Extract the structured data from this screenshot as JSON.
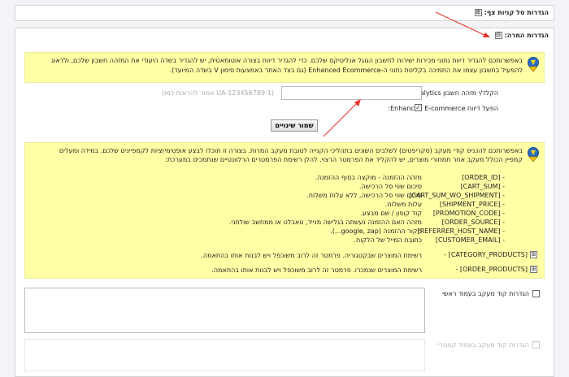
{
  "collapsed_panel": {
    "title": "הגדרות סל קניות צף:",
    "toggle_symbol": "⊞"
  },
  "open_panel": {
    "title": "הגדרות המרה:",
    "toggle_symbol": "⊟"
  },
  "note1": {
    "text": "באפשרותכם להגדיר דיווח נתוני מכירות ישירות לחשבון הגוגל אנליטיקס שלכם. כדי להגדיר דיווח בצורה אוטומאטית, יש להגדיר בשדה היעודי את המזהה חשבון שלכם, ולדאוג להפעיל בחשבון עצמו את התמיכה בקליטת נתוני ה-Enhanced Ecommerce (גם בצד האתר באמצעות סימון V בשדה המיועד)."
  },
  "ga_field": {
    "label": "הקלד/י מזהה חשבון Google Analytics:",
    "value": "",
    "hint": "(אמור להראות כמו UA-123456789-1)"
  },
  "enhanced_ecommerce": {
    "label": "הפעל דיווח Enhanced E-commerce:",
    "checked_symbol": "✓"
  },
  "save_button": {
    "label": "שמור שינויים"
  },
  "note2": {
    "intro": "באפשרותכם להכניס קודי מעקב (סקריפטים) לשלבים השונים בתהליכי הקנייה לטובת מעקב המרות. בצורה זו תוכלו לבצע אופטימיזציות לקמפיינים שלכם. במידה ומעלים קמפיין הכולל מעקב אחר תמחורי מוצרים, יש להקליד את הפרמטר הרצוי. להלן רשימת הפרמטרים הרלוונטיים שנתמכים במערכת:",
    "params": [
      {
        "code": "[ORDER_ID] -",
        "desc": "מזהה ההזמנה - מוקצה בסוף ההזמנה."
      },
      {
        "code": "[CART_SUM] -",
        "desc": "סיכום שווי סל הרכישה."
      },
      {
        "code": "[CART_SUM_WO_SHIPMENT] -",
        "desc": "סיכום שווי סל הרכישה, ללא עלות משלוח."
      },
      {
        "code": "[SHIPMENT_PRICE] -",
        "desc": "עלות משלוח."
      },
      {
        "code": "[PROMOTION_CODE] -",
        "desc": "קוד קופון / שם מבצע."
      },
      {
        "code": "[ORDER_SOURCE] -",
        "desc": "מזהה האם ההזמנה נעשתה בגלישה מנייד, טאבלט או ממחשב שולחני."
      },
      {
        "code": "[REFERRER_HOST_NAME] -",
        "desc": "מקור ההזמנה (google, zap...)."
      },
      {
        "code": "[CUSTOMER_EMAIL] -",
        "desc": "כתובת המייל של הלקוח."
      }
    ],
    "category_products": {
      "code": "[CATEGORY_PRODUCTS] -",
      "desc": "רשימת המוצרים שבקטגוריה. פרמטר זה לרוב משוכפל ויש לבנות אותו בהתאמה."
    },
    "order_products": {
      "code": "[ORDER_PRODUCTS] -",
      "desc": "רשימת המוצרים שנמכרו. פרמטר זה לרוב משוכפל ויש לבנות אותו בהתאמה."
    },
    "expand_symbol": "⊞"
  },
  "tracking_home": {
    "label": "הגדרות קוד מעקב בעמוד ראשי"
  },
  "tracking_other": {
    "label": "הגדרות קוד מעקב בעמוד קטגורי"
  },
  "colors": {
    "note_bg": "#ffffa6",
    "arrow": "#e8312a"
  }
}
